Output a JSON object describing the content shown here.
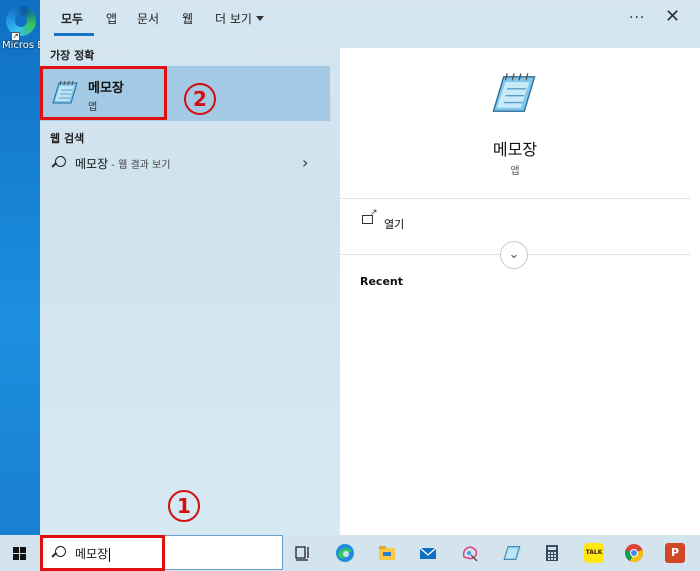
{
  "desktop": {
    "edge_label": "Micros Edge"
  },
  "tabs": [
    {
      "label": "모두",
      "active": true
    },
    {
      "label": "앱"
    },
    {
      "label": "문서"
    },
    {
      "label": "웹"
    },
    {
      "label": "더 보기"
    }
  ],
  "toolbar": {
    "more_options": "···",
    "close": "✕"
  },
  "best_match": {
    "section_label": "가장 정확",
    "title": "메모장",
    "subtitle": "앱"
  },
  "web_search": {
    "section_label": "웹 검색",
    "query": "메모장",
    "suffix": " - 웹 결과 보기",
    "chevron": "›"
  },
  "detail": {
    "title": "메모장",
    "subtitle": "앱",
    "open_label": "열기",
    "expand": "⌄",
    "recent_label": "Recent"
  },
  "annotations": {
    "step1": "1",
    "step2": "2",
    "color": "#e01010"
  },
  "taskbar": {
    "search_value": "메모장",
    "icons": [
      "task-view-icon",
      "edge-icon",
      "file-explorer-icon",
      "mail-icon",
      "paint3d-icon",
      "notepad-icon",
      "calculator-icon",
      "kakaotalk-icon",
      "chrome-icon",
      "powerpoint-icon"
    ],
    "kakao_label": "TALK",
    "ppt_label": "P"
  },
  "colors": {
    "accent": "#1973c4",
    "selected": "#a4c9e4",
    "annotation": "#e01010"
  }
}
